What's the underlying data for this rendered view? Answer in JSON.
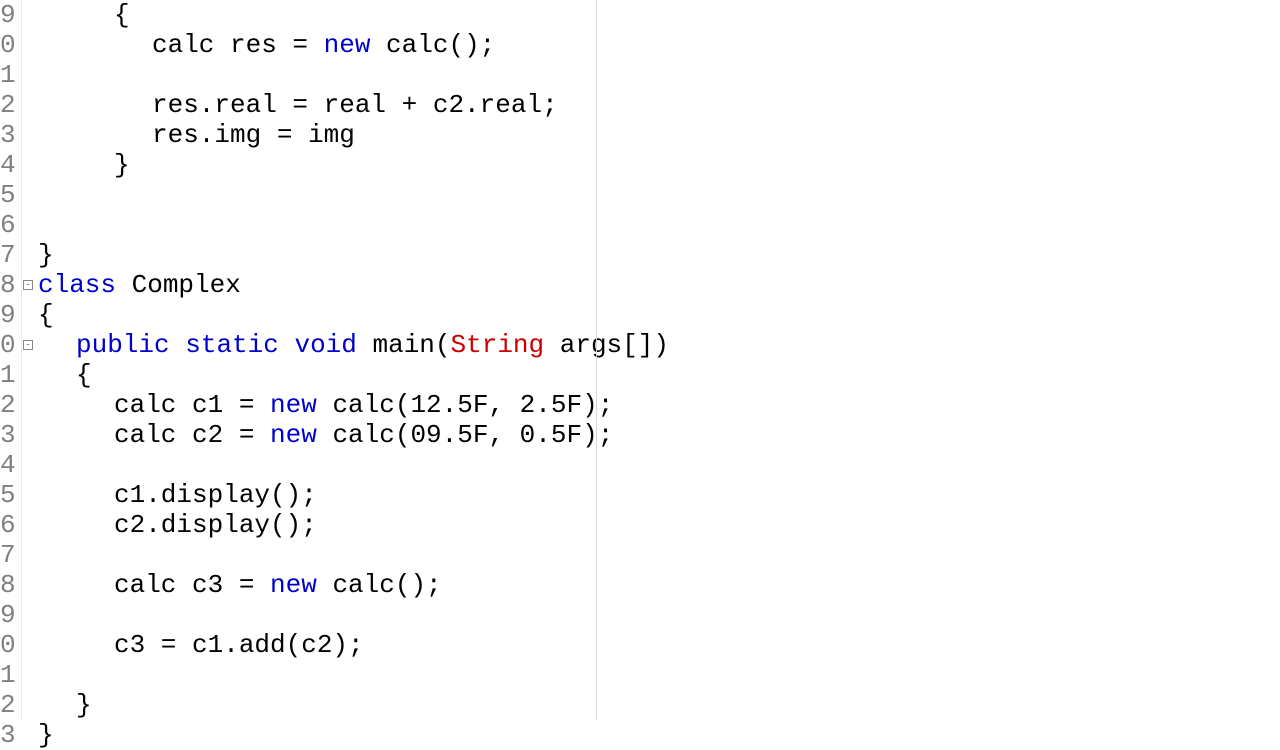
{
  "gutter": [
    "9",
    "0",
    "1",
    "2",
    "3",
    "4",
    "5",
    "6",
    "7",
    "8",
    "9",
    "0",
    "1",
    "2",
    "3",
    "4",
    "5",
    "6",
    "7",
    "8",
    "9",
    "0",
    "1",
    "2",
    "3"
  ],
  "fold_markers": [
    {
      "line_index": 9,
      "symbol": "-"
    },
    {
      "line_index": 11,
      "symbol": "-"
    }
  ],
  "code": [
    {
      "indent": "        ",
      "segments": [
        {
          "t": "{",
          "c": "txt"
        }
      ]
    },
    {
      "indent": "            ",
      "segments": [
        {
          "t": "calc res = ",
          "c": "txt"
        },
        {
          "t": "new",
          "c": "kw"
        },
        {
          "t": " calc();",
          "c": "txt"
        }
      ]
    },
    {
      "indent": "",
      "segments": []
    },
    {
      "indent": "            ",
      "segments": [
        {
          "t": "res.real = real + c2.real;",
          "c": "txt"
        }
      ]
    },
    {
      "indent": "            ",
      "segments": [
        {
          "t": "res.img = img",
          "c": "txt"
        }
      ]
    },
    {
      "indent": "        ",
      "segments": [
        {
          "t": "}",
          "c": "txt"
        }
      ]
    },
    {
      "indent": "",
      "segments": []
    },
    {
      "indent": "",
      "segments": []
    },
    {
      "indent": "",
      "segments": [
        {
          "t": "}",
          "c": "txt"
        }
      ]
    },
    {
      "indent": "",
      "segments": [
        {
          "t": "class",
          "c": "kw"
        },
        {
          "t": " Complex",
          "c": "txt"
        }
      ]
    },
    {
      "indent": "",
      "segments": [
        {
          "t": "{",
          "c": "txt"
        }
      ]
    },
    {
      "indent": "    ",
      "segments": [
        {
          "t": "public",
          "c": "kw"
        },
        {
          "t": " ",
          "c": "txt"
        },
        {
          "t": "static",
          "c": "kw"
        },
        {
          "t": " ",
          "c": "txt"
        },
        {
          "t": "void",
          "c": "kw"
        },
        {
          "t": " main(",
          "c": "txt"
        },
        {
          "t": "String",
          "c": "type"
        },
        {
          "t": " args[])",
          "c": "txt"
        }
      ]
    },
    {
      "indent": "    ",
      "segments": [
        {
          "t": "{",
          "c": "txt"
        }
      ]
    },
    {
      "indent": "        ",
      "segments": [
        {
          "t": "calc c1 = ",
          "c": "txt"
        },
        {
          "t": "new",
          "c": "kw"
        },
        {
          "t": " calc(12.5F, 2.5F);",
          "c": "txt"
        }
      ]
    },
    {
      "indent": "        ",
      "segments": [
        {
          "t": "calc c2 = ",
          "c": "txt"
        },
        {
          "t": "new",
          "c": "kw"
        },
        {
          "t": " calc(09.5F, 0.5F);",
          "c": "txt"
        }
      ]
    },
    {
      "indent": "",
      "segments": []
    },
    {
      "indent": "        ",
      "segments": [
        {
          "t": "c1.display();",
          "c": "txt"
        }
      ]
    },
    {
      "indent": "        ",
      "segments": [
        {
          "t": "c2.display();",
          "c": "txt"
        }
      ]
    },
    {
      "indent": "",
      "segments": []
    },
    {
      "indent": "        ",
      "segments": [
        {
          "t": "calc c3 = ",
          "c": "txt"
        },
        {
          "t": "new",
          "c": "kw"
        },
        {
          "t": " calc();",
          "c": "txt"
        }
      ]
    },
    {
      "indent": "",
      "segments": []
    },
    {
      "indent": "        ",
      "segments": [
        {
          "t": "c3 = c1.add(c2);",
          "c": "txt"
        }
      ]
    },
    {
      "indent": "",
      "segments": []
    },
    {
      "indent": "    ",
      "segments": [
        {
          "t": "}",
          "c": "txt"
        }
      ]
    },
    {
      "indent": "",
      "segments": [
        {
          "t": "}",
          "c": "txt"
        }
      ]
    }
  ]
}
